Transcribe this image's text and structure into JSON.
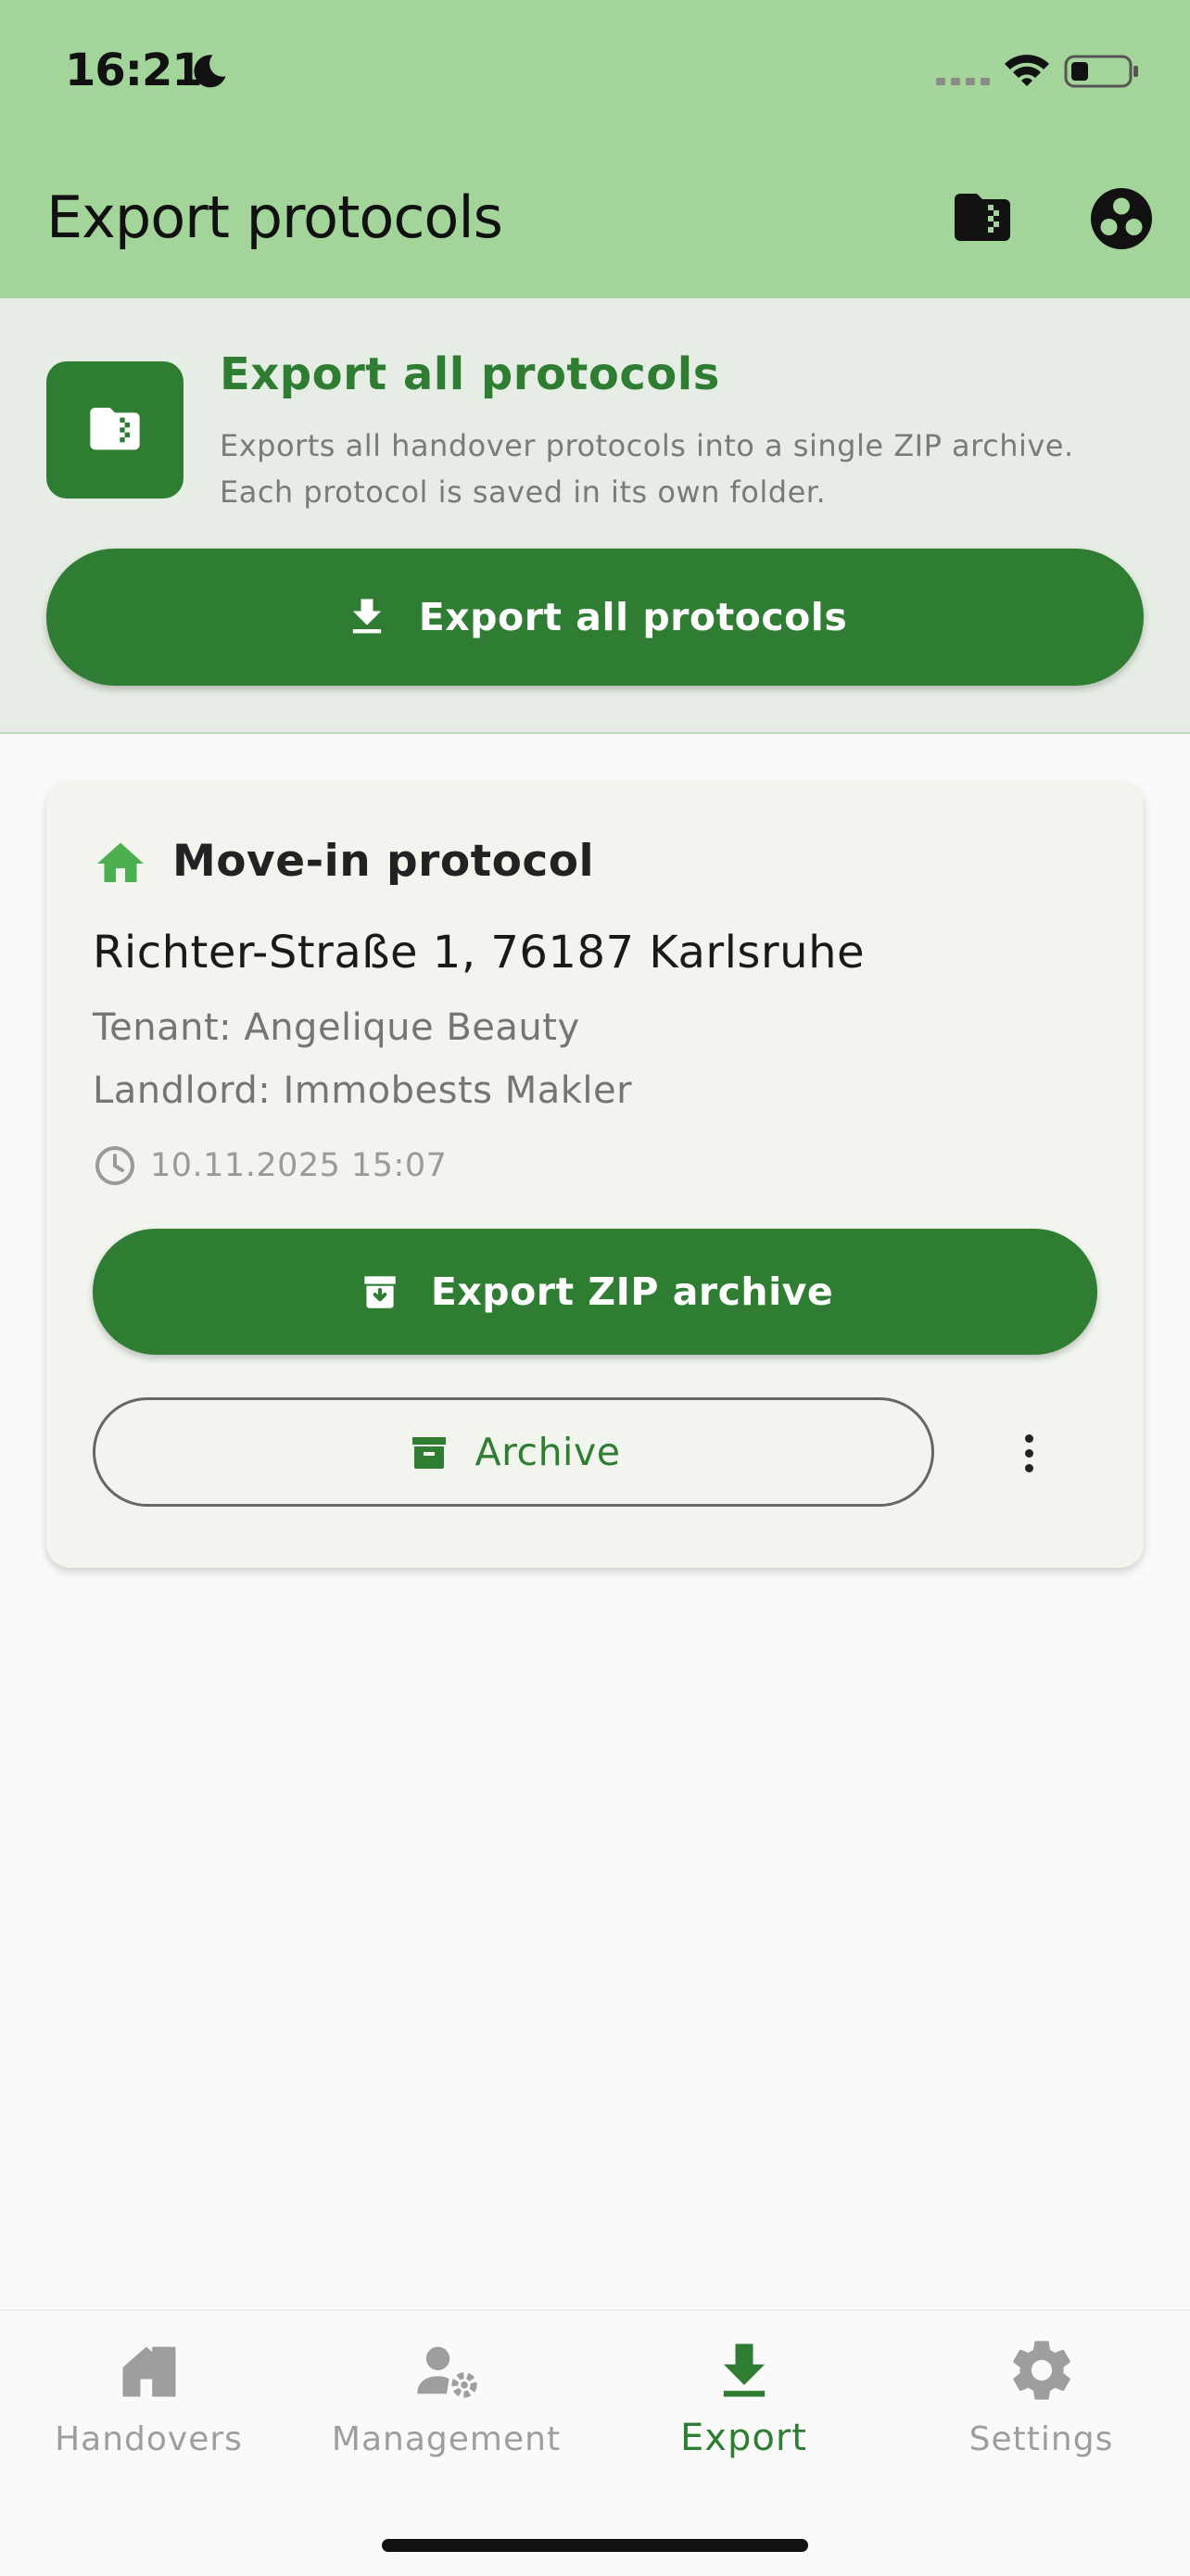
{
  "status_bar": {
    "time": "16:21"
  },
  "app_bar": {
    "title": "Export protocols"
  },
  "export_all": {
    "title": "Export all protocols",
    "description": "Exports all handover protocols into a single ZIP archive. Each protocol is saved in its own folder.",
    "button_label": "Export all protocols"
  },
  "protocol_card": {
    "type_label": "Move-in protocol",
    "address": "Richter-Straße 1, 76187 Karlsruhe",
    "tenant": "Tenant: Angelique Beauty",
    "landlord": "Landlord: Immobests Makler",
    "datetime": "10.11.2025 15:07",
    "export_zip_label": "Export ZIP archive",
    "archive_label": "Archive"
  },
  "bottom_nav": {
    "items": [
      {
        "label": "Handovers",
        "icon": "house-icon"
      },
      {
        "label": "Management",
        "icon": "person-gear-icon"
      },
      {
        "label": "Export",
        "icon": "download-icon",
        "active": true
      },
      {
        "label": "Settings",
        "icon": "gear-icon"
      }
    ]
  },
  "colors": {
    "app_bar": "#a3d49a",
    "primary": "#2e7d32",
    "section_bg": "#e5ede4",
    "card_bg": "#f1f5ee",
    "accent_icon": "#4caf50"
  }
}
